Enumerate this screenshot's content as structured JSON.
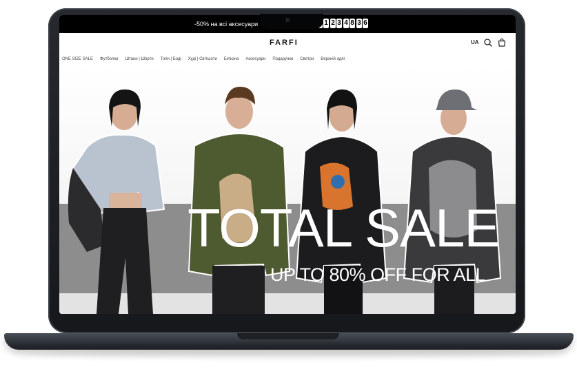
{
  "announcement": {
    "promo_text": "-50% на всі аксесуари",
    "countdown": [
      {
        "unit": "days",
        "value": "01"
      },
      {
        "unit": "hours",
        "value": "23"
      },
      {
        "unit": "minutes",
        "value": "48"
      },
      {
        "unit": "seconds",
        "value": "36"
      }
    ]
  },
  "header": {
    "logo": "FARFI",
    "language": "UA",
    "icons": [
      "search-icon",
      "cart-icon"
    ]
  },
  "nav": {
    "items": [
      "ONE SIZE SALE",
      "Футболки",
      "Штани | Шорти",
      "Топи | Боді",
      "Худі | Світшоти",
      "Білизна",
      "Аксесуари",
      "Подарунки",
      "Светри",
      "Верхній одяг"
    ]
  },
  "hero": {
    "title": "TOTAL SALE",
    "subtitle": "UP TO 80% OFF FOR ALL"
  },
  "colors": {
    "topbar": "#000000",
    "hero_band": "#8d8d8d",
    "laptop_frame": "#1c1e22"
  }
}
